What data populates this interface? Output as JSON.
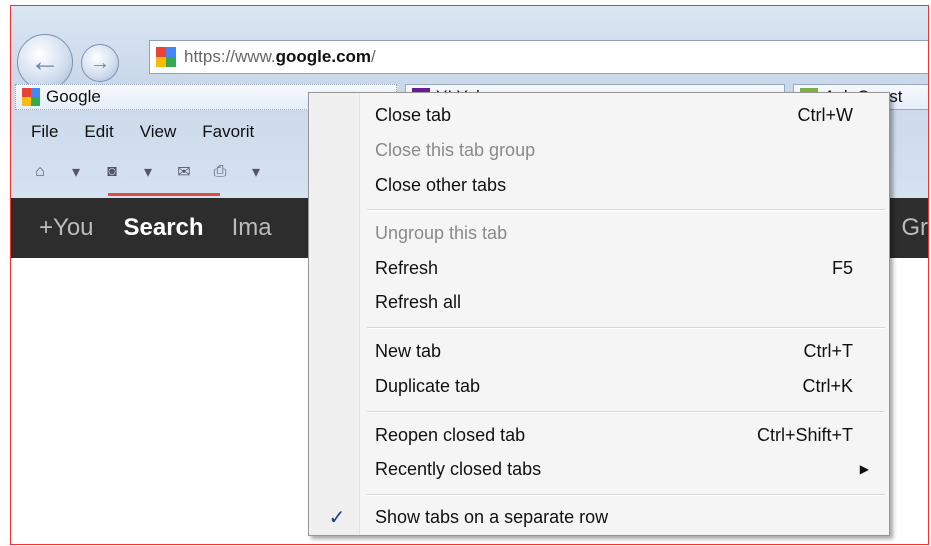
{
  "browser": {
    "address": {
      "scheme": "https://www.",
      "host": "google.com",
      "path": "/"
    },
    "tabs": [
      {
        "label": "Google"
      },
      {
        "label": "Y! Yahoo"
      },
      {
        "label": "Ask Quest"
      }
    ],
    "menubar": [
      "File",
      "Edit",
      "View",
      "Favorit"
    ],
    "google_bar": {
      "items": [
        "+You",
        "Search",
        "Ima"
      ],
      "right_fragment": "Gr"
    }
  },
  "context_menu": {
    "items": [
      {
        "label": "Close tab",
        "shortcut": "Ctrl+W"
      },
      {
        "label": "Close this tab group",
        "shortcut": ""
      },
      {
        "label": "Close other tabs",
        "shortcut": ""
      },
      {
        "label": "Ungroup this tab",
        "shortcut": ""
      },
      {
        "label": "Refresh",
        "shortcut": "F5"
      },
      {
        "label": "Refresh all",
        "shortcut": ""
      },
      {
        "label": "New tab",
        "shortcut": "Ctrl+T"
      },
      {
        "label": "Duplicate tab",
        "shortcut": "Ctrl+K"
      },
      {
        "label": "Reopen closed tab",
        "shortcut": "Ctrl+Shift+T"
      },
      {
        "label": "Recently closed tabs",
        "shortcut": ""
      },
      {
        "label": "Show tabs on a separate row",
        "shortcut": ""
      }
    ],
    "checkmark": "✓",
    "submenu_arrow": "▶"
  },
  "colors": {
    "frame_border": "#ee3333",
    "google_bar": "#2d2d2d",
    "active_indicator": "#dd4b39"
  }
}
